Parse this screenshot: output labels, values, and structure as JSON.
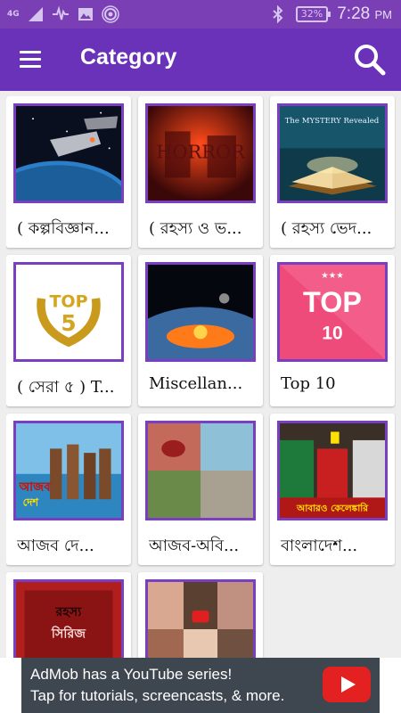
{
  "status_bar": {
    "network_label": "4G",
    "battery_percent": "32%",
    "time": "7:28",
    "time_suffix": "PM",
    "icons": [
      "signal-icon",
      "data-activity-icon",
      "image-icon",
      "hotspot-icon",
      "bluetooth-icon",
      "battery-icon"
    ]
  },
  "app_bar": {
    "title": "Category",
    "menu_icon": "hamburger-menu-icon",
    "search_icon": "search-icon",
    "background": "#6a32b8"
  },
  "categories": [
    {
      "label": "( কল্পবিজ্ঞান...",
      "thumb": "space-ships"
    },
    {
      "label": "( রহস্য ও ভ...",
      "thumb": "horror-red"
    },
    {
      "label": "( রহস্য ভেদ...",
      "thumb": "mystery-book",
      "thumb_text": "The MYSTERY Revealed"
    },
    {
      "label": "( সেরা ৫ ) T...",
      "thumb": "top5-laurel",
      "thumb_text": "TOP 5"
    },
    {
      "label": "Miscellan...",
      "thumb": "meteor-impact"
    },
    {
      "label": "Top 10",
      "thumb": "top10-pink",
      "thumb_text": "TOP 10"
    },
    {
      "label": "আজব দে...",
      "thumb": "beach-people",
      "thumb_text": "আজব দেশ"
    },
    {
      "label": "আজব-অবি...",
      "thumb": "photo-collage"
    },
    {
      "label": "বাংলাদেশ...",
      "thumb": "cricket-actress",
      "thumb_text": "আবারও কেলেঙ্কারি"
    },
    {
      "label": "",
      "thumb": "red-poster",
      "thumb_text": "রহস্য সিরিজ"
    },
    {
      "label": "",
      "thumb": "celebrity-collage"
    }
  ],
  "ad_banner": {
    "line1": "AdMob has a YouTube series!",
    "line2": "Tap for tutorials, screencasts, & more.",
    "icon": "youtube-play-icon"
  }
}
